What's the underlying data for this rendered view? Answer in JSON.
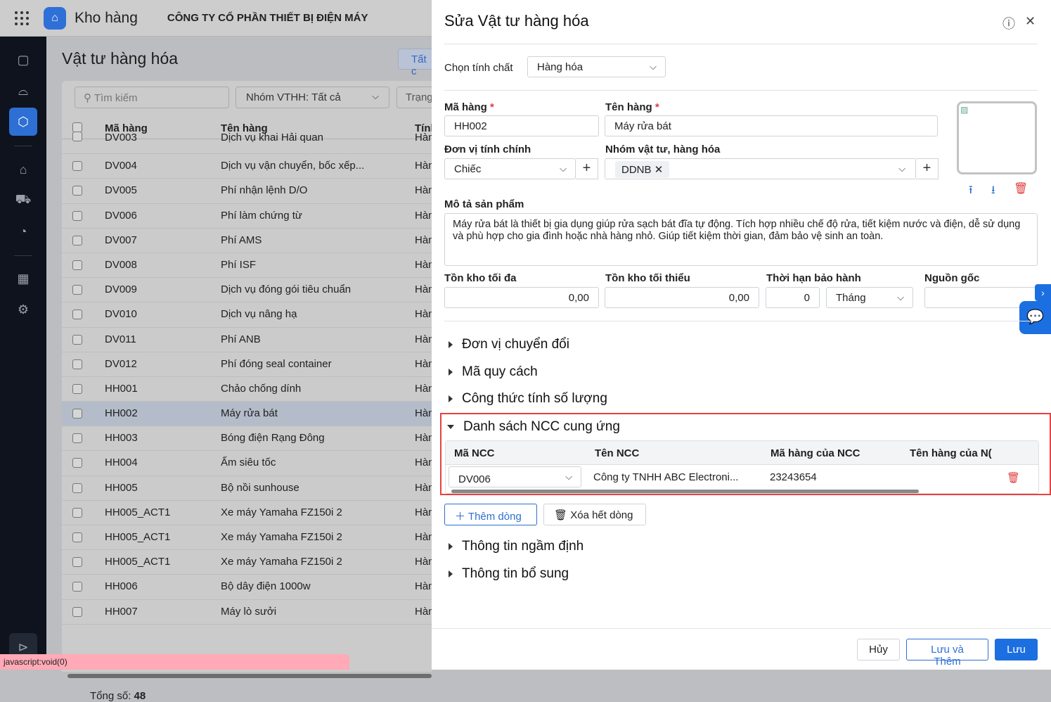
{
  "topbar": {
    "app_name": "Kho hàng",
    "company": "CÔNG TY CỔ PHẦN THIẾT BỊ ĐIỆN MÁY"
  },
  "page": {
    "title": "Vật tư hàng hóa",
    "tab_all": "Tất c",
    "search_placeholder": "Tìm kiếm",
    "group_filter": "Nhóm VTHH: Tất cả",
    "status_filter": "Trạng",
    "total_label": "Tổng số:",
    "total": "48"
  },
  "table": {
    "headers": [
      "Mã hàng",
      "Tên hàng",
      "Tính"
    ],
    "rows": [
      {
        "code": "DV003",
        "name": "Dịch vụ khai Hải quan",
        "type": "Hàn"
      },
      {
        "code": "DV004",
        "name": "Dịch vụ vận chuyển, bốc xếp...",
        "type": "Hàn"
      },
      {
        "code": "DV005",
        "name": "Phí nhận lệnh D/O",
        "type": "Hàn"
      },
      {
        "code": "DV006",
        "name": "Phí làm chứng từ",
        "type": "Hàn"
      },
      {
        "code": "DV007",
        "name": "Phí AMS",
        "type": "Hàn"
      },
      {
        "code": "DV008",
        "name": "Phí ISF",
        "type": "Hàn"
      },
      {
        "code": "DV009",
        "name": "Dịch vụ đóng gói tiêu chuẩn",
        "type": "Hàn"
      },
      {
        "code": "DV010",
        "name": "Dịch vụ nâng hạ",
        "type": "Hàn"
      },
      {
        "code": "DV011",
        "name": "Phí ANB",
        "type": "Hàn"
      },
      {
        "code": "DV012",
        "name": "Phí đóng seal container",
        "type": "Hàn"
      },
      {
        "code": "HH001",
        "name": "Chảo chống dính",
        "type": "Hàn"
      },
      {
        "code": "HH002",
        "name": "Máy rửa bát",
        "type": "Hàn",
        "selected": true
      },
      {
        "code": "HH003",
        "name": "Bóng điện Rạng Đông",
        "type": "Hàn"
      },
      {
        "code": "HH004",
        "name": "Ấm siêu tốc",
        "type": "Hàn"
      },
      {
        "code": "HH005",
        "name": "Bộ nồi sunhouse",
        "type": "Hàn"
      },
      {
        "code": "HH005_ACT1",
        "name": "Xe máy Yamaha FZ150i 2",
        "type": "Hàn"
      },
      {
        "code": "HH005_ACT1",
        "name": "Xe máy Yamaha FZ150i 2",
        "type": "Hàn"
      },
      {
        "code": "HH005_ACT1",
        "name": "Xe máy Yamaha FZ150i 2",
        "type": "Hàn"
      },
      {
        "code": "HH006",
        "name": "Bộ dây điện 1000w",
        "type": "Hàn"
      },
      {
        "code": "HH007",
        "name": "Máy lò sưởi",
        "type": "Hàn"
      }
    ]
  },
  "status_bar": "javascript:void(0)",
  "drawer": {
    "title": "Sửa Vật tư hàng hóa",
    "nature_label": "Chọn tính chất",
    "nature_value": "Hàng hóa",
    "code_label": "Mã hàng",
    "code_value": "HH002",
    "name_label": "Tên hàng",
    "name_value": "Máy rửa bát",
    "unit_label": "Đơn vị tính chính",
    "unit_value": "Chiếc",
    "group_label": "Nhóm vật tư, hàng hóa",
    "group_tag": "DDNB",
    "desc_label": "Mô tả sản phẩm",
    "desc_value": "Máy rửa bát là thiết bị gia dụng giúp rửa sạch bát đĩa tự động. Tích hợp nhiều chế độ rửa, tiết kiệm nước và điện, dễ sử dụng và phù hợp cho gia đình hoặc nhà hàng nhỏ. Giúp tiết kiệm thời gian, đảm bảo vệ sinh an toàn.",
    "max_label": "Tồn kho tối đa",
    "max_value": "0,00",
    "min_label": "Tồn kho tối thiểu",
    "min_value": "0,00",
    "warranty_label": "Thời hạn bảo hành",
    "warranty_value": "0",
    "warranty_unit": "Tháng",
    "origin_label": "Nguồn gốc",
    "origin_value": "",
    "sections": [
      "Đơn vị chuyển đổi",
      "Mã quy cách",
      "Công thức tính số lượng",
      "Danh sách NCC cung ứng",
      "Thông tin ngầm định",
      "Thông tin bổ sung"
    ],
    "ncc": {
      "headers": [
        "Mã NCC",
        "Tên NCC",
        "Mã hàng của NCC",
        "Tên hàng của N("
      ],
      "row": {
        "code": "DV006",
        "name": "Công ty TNHH ABC Electroni...",
        "item_code": "23243654",
        "item_name": ""
      }
    },
    "add_row": "Thêm dòng",
    "clear_rows": "Xóa hết dòng",
    "cancel": "Hủy",
    "save_add": "Lưu và Thêm",
    "save": "Lưu"
  },
  "colors": {
    "accent": "#1c6fe0",
    "danger": "#e03b3b",
    "highlight_border": "#e84040"
  }
}
